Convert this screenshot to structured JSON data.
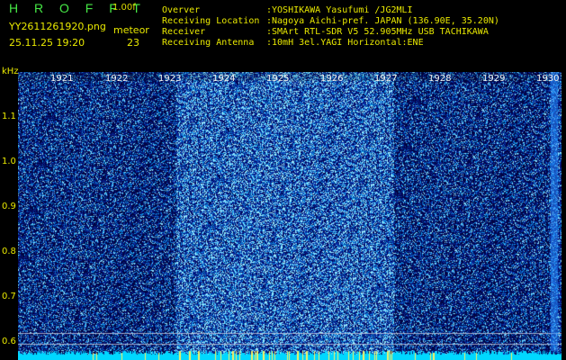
{
  "header": {
    "brand": "H R O F F T",
    "version": "1.00f",
    "filename": "YY2611261920.png",
    "datetime": "25.11.25 19:20",
    "meteor_label": "meteor",
    "meteor_count": "23"
  },
  "info": {
    "observer_label": "Overver",
    "observer_value": ":YOSHIKAWA Yasufumi /JG2MLI",
    "location_label": "Receiving Location",
    "location_value": ":Nagoya Aichi-pref. JAPAN (136.90E, 35.20N)",
    "receiver_label": "Receiver",
    "receiver_value": ":SMArt RTL-SDR V5 52.905MHz USB TACHIKAWA",
    "antenna_label": "Receiving Antenna",
    "antenna_value": ":10mH 3el.YAGI Horizontal:ENE"
  },
  "axis": {
    "y_unit": "kHz",
    "y_ticks": [
      "1.1",
      "1.0",
      "0.9",
      "0.8",
      "0.7",
      "0.6"
    ],
    "x_ticks": [
      "1921",
      "1922",
      "1923",
      "1924",
      "1925",
      "1926",
      "1927",
      "1928",
      "1929",
      "1930"
    ]
  },
  "colors": {
    "label_yellow": "#e8e800",
    "brand_green": "#46e846",
    "background": "#000000",
    "spectrogram_dark": "#0a1478",
    "spectrogram_bright": "#1e9bff",
    "noise_floor": "#00d8ff"
  }
}
